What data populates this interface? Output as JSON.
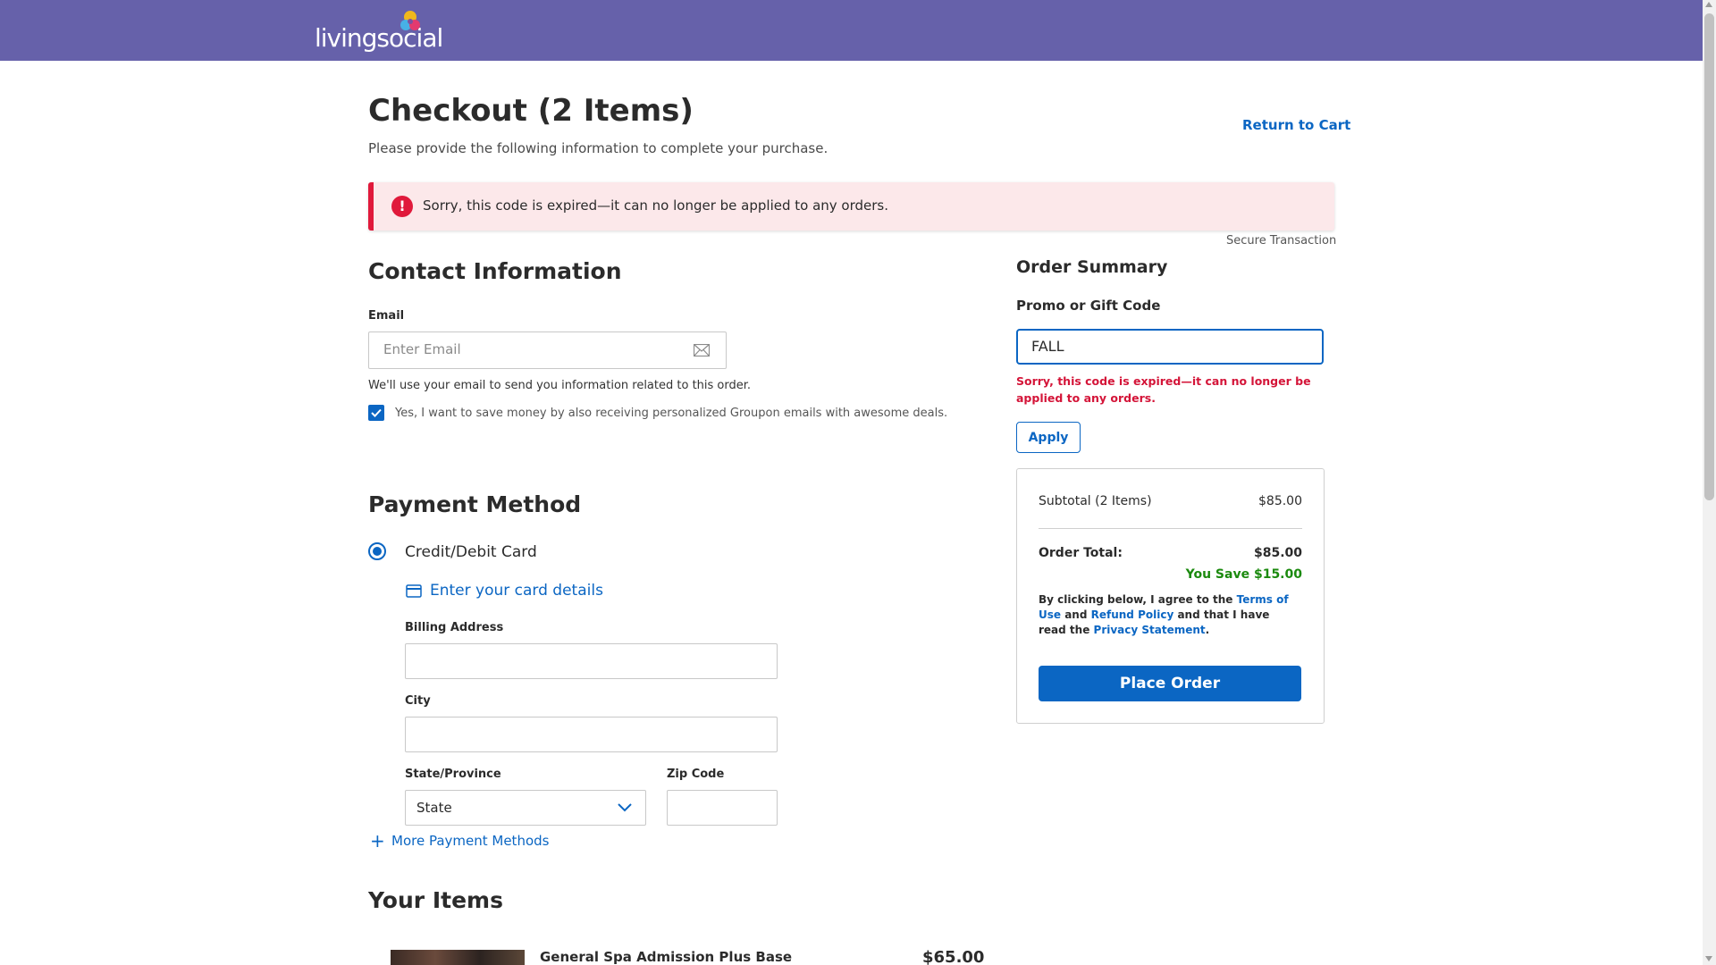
{
  "brand": {
    "logo_text": "livingsocial",
    "header_color": "#6661aa",
    "accent": "#0b66c3",
    "error": "#e0193b"
  },
  "header": {
    "title": "Checkout (2 Items)",
    "subtitle": "Please provide the following information to complete your purchase.",
    "return_link": "Return to Cart"
  },
  "alert": {
    "message": "Sorry, this code is expired—it can no longer be applied to any orders."
  },
  "secure_label": "Secure Transaction",
  "contact": {
    "title": "Contact Information",
    "email_label": "Email",
    "email_placeholder": "Enter Email",
    "email_value": "",
    "email_note": "We'll use your email to send you information related to this order.",
    "optin_checked": true,
    "optin_text": "Yes, I want to save money by also receiving personalized Groupon emails with awesome deals."
  },
  "payment": {
    "title": "Payment Method",
    "method_label": "Credit/Debit Card",
    "card_link": "Enter your card details",
    "billing_label": "Billing Address",
    "city_label": "City",
    "state_label": "State/Province",
    "state_value": "State",
    "zip_label": "Zip Code",
    "more_methods": "More Payment Methods"
  },
  "items": {
    "title": "Your Items",
    "list": [
      {
        "name": "General Spa Admission Plus Base",
        "price": "$65.00"
      }
    ]
  },
  "summary": {
    "title": "Order Summary",
    "promo_label": "Promo or Gift Code",
    "promo_value": "FALL",
    "promo_error": "Sorry, this code is expired—it can no longer be applied to any orders.",
    "apply_label": "Apply",
    "subtotal_label": "Subtotal (2 Items)",
    "subtotal_value": "$85.00",
    "total_label": "Order Total:",
    "total_value": "$85.00",
    "savings": "You Save $15.00",
    "legal_1": "By clicking below, I agree to the ",
    "terms": "Terms of Use",
    "legal_2": " and ",
    "refund": "Refund Policy",
    "legal_3": " and that I have read the ",
    "privacy": "Privacy Statement",
    "legal_4": ".",
    "place_order": "Place Order"
  }
}
